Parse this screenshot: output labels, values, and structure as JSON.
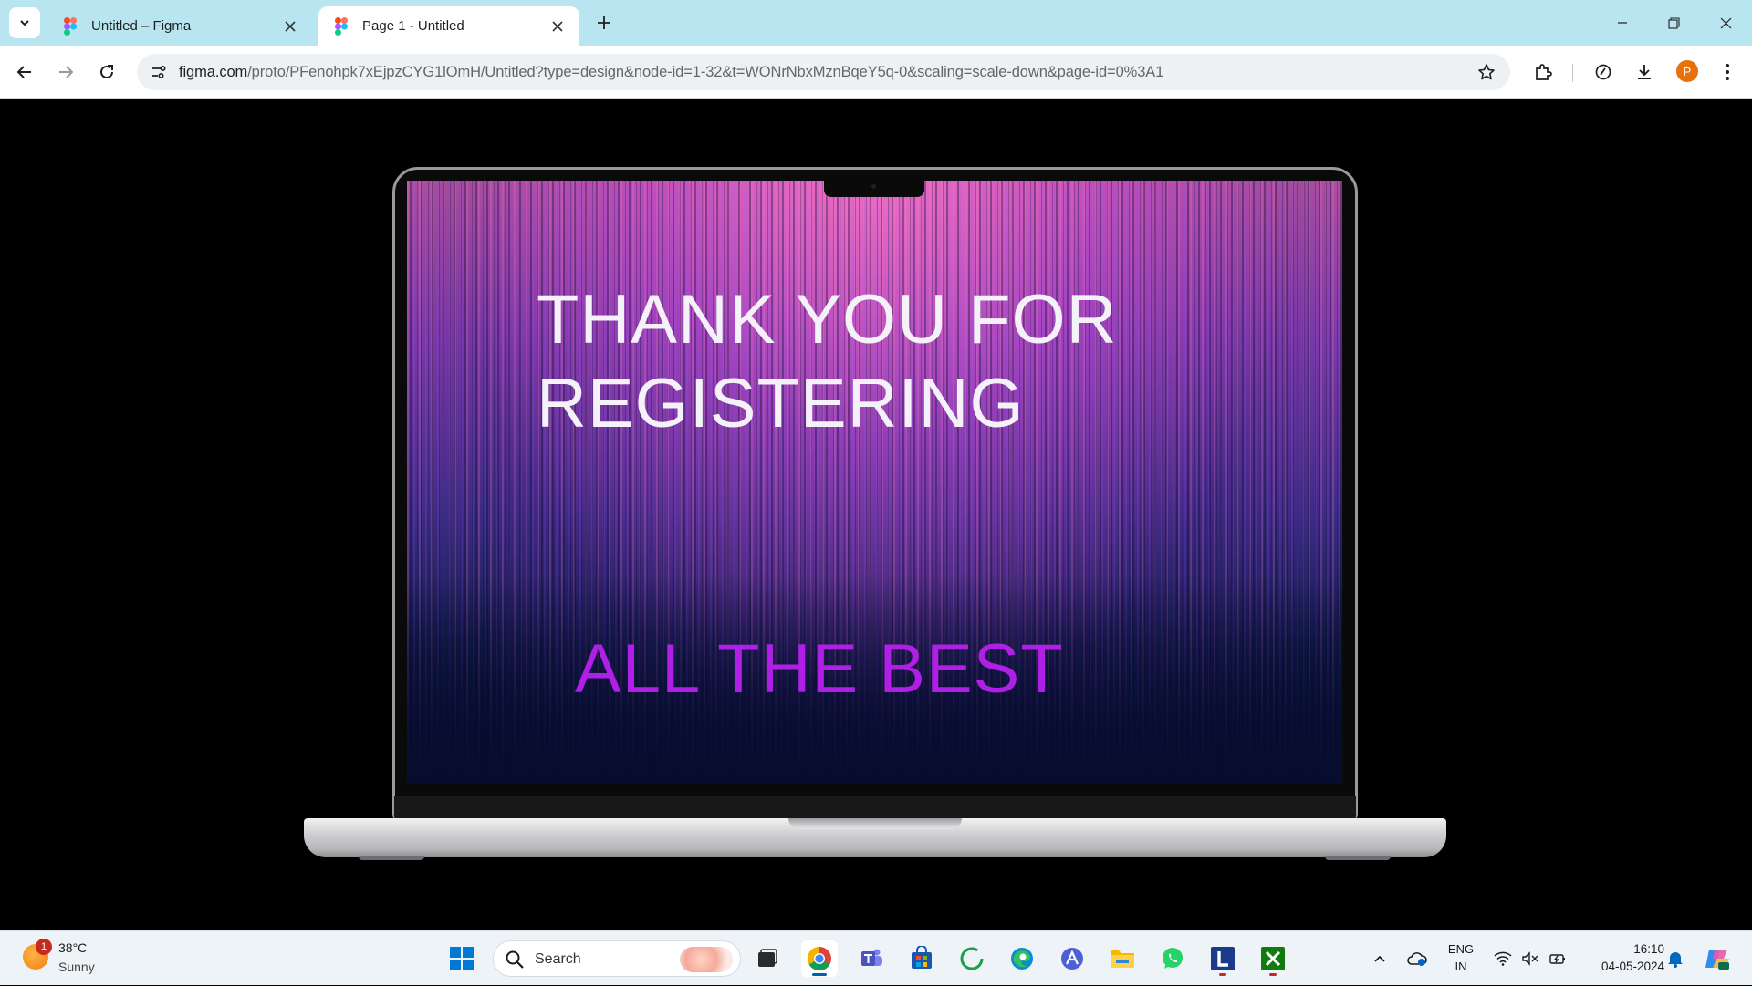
{
  "browser": {
    "tabs": [
      {
        "title": "Untitled – Figma",
        "active": false
      },
      {
        "title": "Page 1 - Untitled",
        "active": true
      }
    ],
    "url_host": "figma.com",
    "url_path": "/proto/PFenohpk7xEjpzCYG1lOmH/Untitled?type=design&node-id=1-32&t=WONrNbxMznBqeY5q-0&scaling=scale-down&page-id=0%3A1",
    "profile_initial": "P"
  },
  "prototype": {
    "heading_line1": "THANK YOU FOR",
    "heading_line2": "REGISTERING",
    "subheading": "ALL THE BEST",
    "heading_color": "#f4f1f8",
    "subheading_color": "#b01fe6"
  },
  "taskbar": {
    "weather_temp": "38°C",
    "weather_condition": "Sunny",
    "weather_badge": "1",
    "search_placeholder": "Search",
    "language_line1": "ENG",
    "language_line2": "IN",
    "time": "16:10",
    "date": "04-05-2024",
    "apps": [
      "windows-start",
      "task-view",
      "chrome",
      "teams",
      "microsoft-store",
      "circle-app",
      "edge",
      "arc-app",
      "file-explorer",
      "whatsapp",
      "l-app",
      "xbox"
    ]
  }
}
